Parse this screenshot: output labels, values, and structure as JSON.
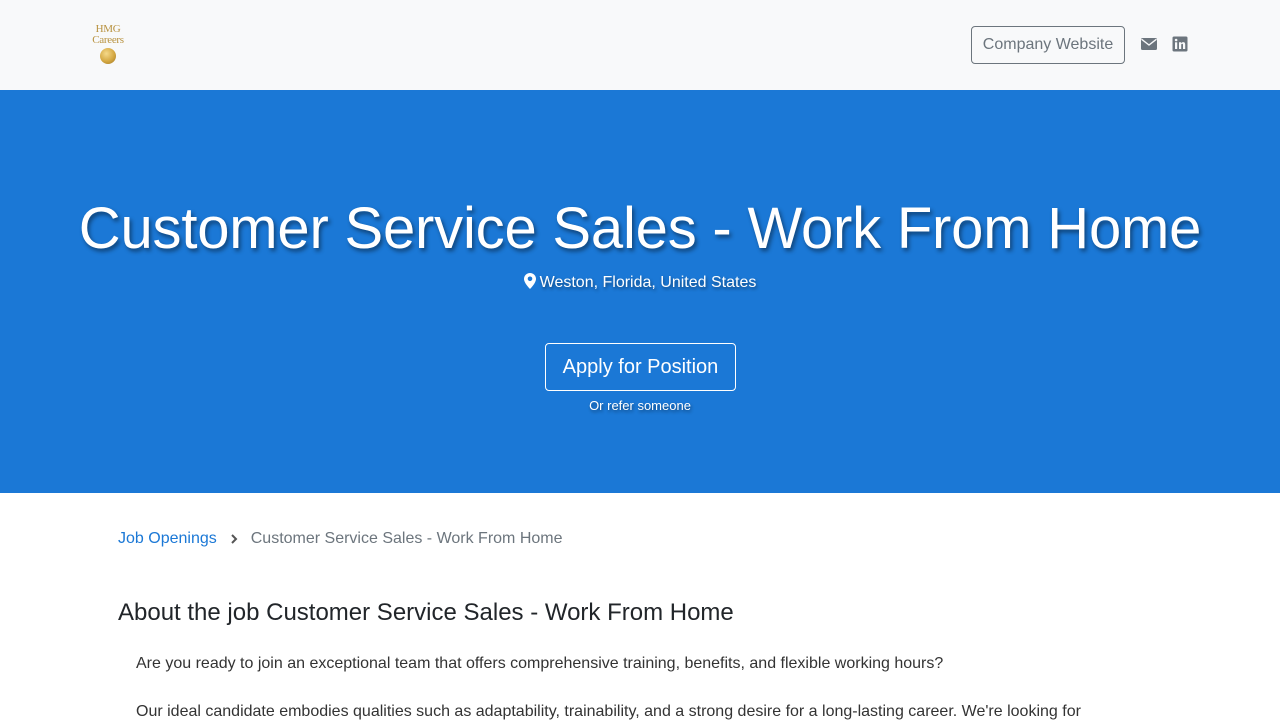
{
  "nav": {
    "logo_line1": "HMG",
    "logo_line2": "Careers",
    "company_website_label": "Company Website"
  },
  "hero": {
    "title": "Customer Service Sales - Work From Home",
    "location": "Weston, Florida, United States",
    "apply_label": "Apply for Position",
    "refer_label": "Or refer someone"
  },
  "breadcrumb": {
    "parent": "Job Openings",
    "current": "Customer Service Sales - Work From Home"
  },
  "content": {
    "about_title": "About the job Customer Service Sales - Work From Home",
    "paragraph1": "Are you ready to join an exceptional team that offers comprehensive training, benefits, and flexible working hours?",
    "paragraph2": "Our ideal candidate embodies qualities such as adaptability, trainability, and a strong desire for a long-lasting career. We're looking for"
  },
  "colors": {
    "hero_bg": "#1b78d6",
    "nav_bg": "#f8f9fa",
    "link": "#1b78d6",
    "muted": "#6c757d"
  },
  "icons": [
    "envelope-icon",
    "linkedin-icon",
    "map-marker-icon",
    "chevron-right-icon"
  ]
}
